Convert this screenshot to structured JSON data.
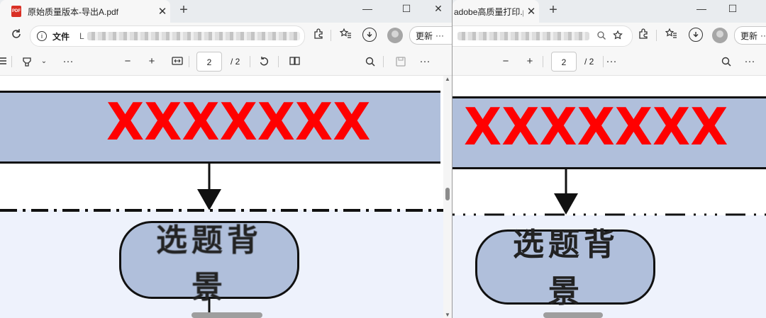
{
  "left": {
    "tab_title": "原始质量版本-导出A.pdf",
    "pdf_badge": "PDF",
    "tab_close": "✕",
    "new_tab": "+",
    "win_min": "—",
    "win_max": "☐",
    "win_close": "✕",
    "scheme_label": "文件",
    "url_start": "L",
    "update_label": "更新",
    "more": "···",
    "page_value": "2",
    "page_total": "/ 2",
    "diagram_red": "XXXXXXX",
    "diagram_box_line1": "选题背",
    "diagram_box_line2": "景"
  },
  "right": {
    "tab_title": "adobe高质量打印.pdf",
    "tab_close": "✕",
    "new_tab": "+",
    "win_min": "—",
    "win_max": "☐",
    "update_label": "更新",
    "more": "···",
    "page_value": "2",
    "page_total": "/ 2",
    "diagram_red": "XXXXXXX",
    "diagram_box_line1": "选题背",
    "diagram_box_line2": "景"
  },
  "icons": {
    "back": "←",
    "refresh": "↻",
    "info": "i",
    "extensions": "puzzle-icon",
    "favorites": "☆",
    "download": "↓",
    "zoom_out": "−",
    "zoom_in": "+",
    "fit": "fit-page-icon",
    "rotate": "↻",
    "search": "search-icon",
    "save": "save-icon"
  },
  "colors": {
    "diagram_fill": "#b0bfdb",
    "red_text": "#ff0000",
    "lower_section": "#eef2fc"
  }
}
